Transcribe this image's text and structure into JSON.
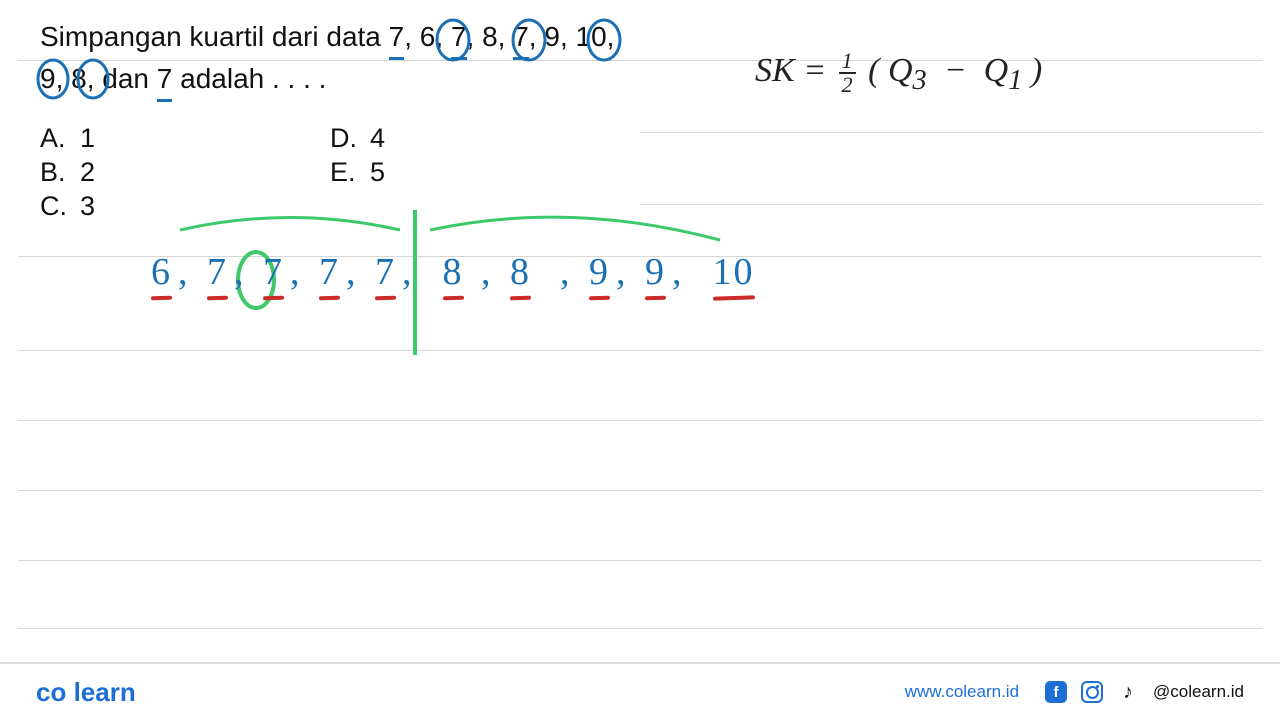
{
  "question": {
    "line1_prefix": "Simpangan kuartil dari data ",
    "data_values": [
      "7",
      "6",
      "7",
      "8",
      "7",
      "9",
      "10",
      "9",
      "8"
    ],
    "line2_prefix": "dan ",
    "last_value": "7",
    "line2_suffix": " adalah . . . ."
  },
  "options": {
    "A": "1",
    "B": "2",
    "C": "3",
    "D": "4",
    "E": "5"
  },
  "sorted_data": [
    "6",
    "7",
    "7",
    "7",
    "7",
    "8",
    "8",
    "9",
    "9",
    "10"
  ],
  "formula": {
    "lhs": "SK",
    "eq": "=",
    "frac_num": "1",
    "frac_den": "2",
    "open": "(",
    "q3": "Q",
    "q3_sub": "3",
    "minus": "−",
    "q1": "Q",
    "q1_sub": "1",
    "close": ")"
  },
  "footer": {
    "logo_co": "co",
    "logo_learn": "learn",
    "url": "www.colearn.id",
    "handle": "@colearn.id",
    "fb": "f"
  }
}
